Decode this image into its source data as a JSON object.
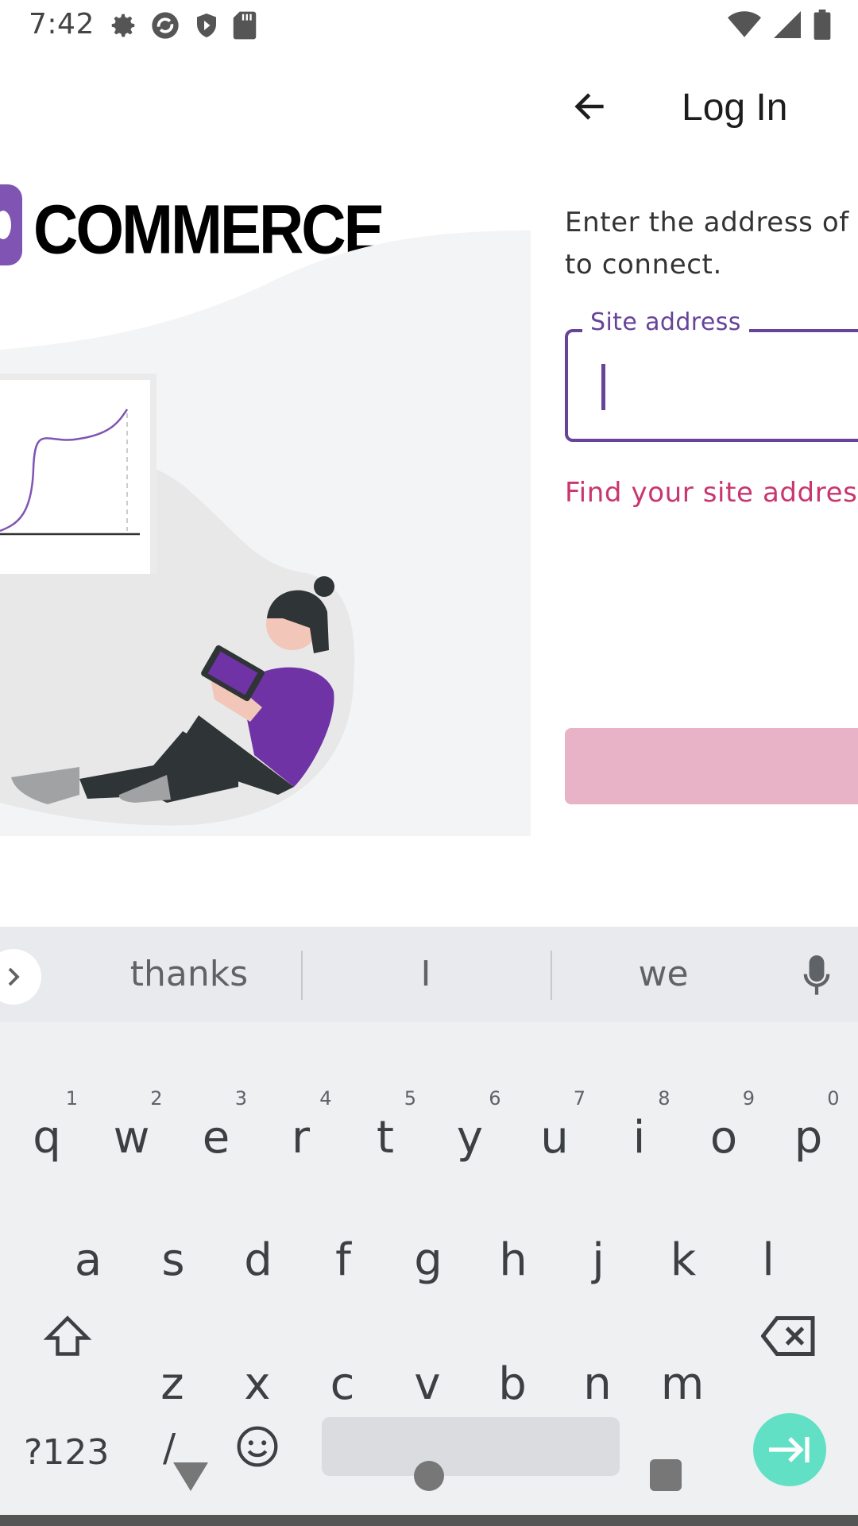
{
  "status_bar": {
    "time": "7:42",
    "left_icons": [
      "gear-icon",
      "sync-icon",
      "shield-play-icon",
      "sd-card-icon"
    ],
    "right_icons": [
      "wifi-icon",
      "cell-signal-icon",
      "battery-icon"
    ]
  },
  "brand": {
    "logo_text": "COMMERCE",
    "accent": "#7f54b3"
  },
  "header": {
    "back_icon": "arrow-back-icon",
    "title": "Log In"
  },
  "login": {
    "instructions": "Enter the address of t\nto connect.",
    "field_label": "Site address",
    "field_value": "",
    "find_link": "Find your site address",
    "continue_label": ""
  },
  "colors": {
    "primary": "#674399",
    "link": "#c9356e",
    "button_disabled": "#e8b3c7"
  },
  "keyboard": {
    "suggestions": [
      "thanks",
      "I",
      "we"
    ],
    "row1": [
      {
        "k": "q",
        "h": "1"
      },
      {
        "k": "w",
        "h": "2"
      },
      {
        "k": "e",
        "h": "3"
      },
      {
        "k": "r",
        "h": "4"
      },
      {
        "k": "t",
        "h": "5"
      },
      {
        "k": "y",
        "h": "6"
      },
      {
        "k": "u",
        "h": "7"
      },
      {
        "k": "i",
        "h": "8"
      },
      {
        "k": "o",
        "h": "9"
      },
      {
        "k": "p",
        "h": "0"
      }
    ],
    "row2": [
      "a",
      "s",
      "d",
      "f",
      "g",
      "h",
      "j",
      "k",
      "l"
    ],
    "row3": [
      "z",
      "x",
      "c",
      "v",
      "b",
      "n",
      "m"
    ],
    "symbols_label": "?123",
    "slash_label": "/"
  }
}
